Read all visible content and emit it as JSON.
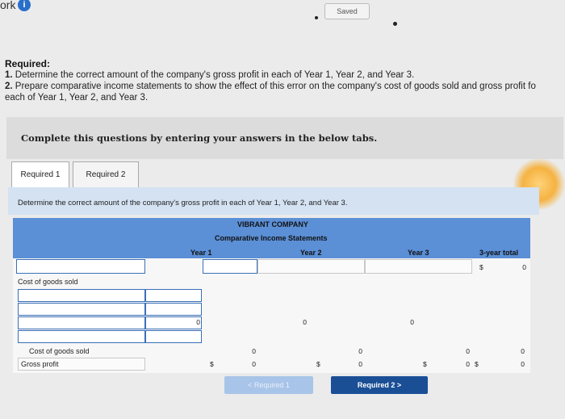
{
  "topbar": {
    "ork": "ork",
    "info_glyph": "i",
    "saved": "Saved"
  },
  "required": {
    "heading": "Required:",
    "item1_num": "1.",
    "item1": "Determine the correct amount of the company's gross profit in each of Year 1, Year 2, and Year 3.",
    "item2_num": "2.",
    "item2_a": "Prepare comparative income statements to show the effect of this error on the company's cost of goods sold and gross profit fo",
    "item2_b": "each of Year 1, Year 2, and Year 3."
  },
  "panel": {
    "text": "Complete this questions by entering your answers in the below tabs."
  },
  "tabs": [
    {
      "label": "Required 1"
    },
    {
      "label": "Required 2"
    }
  ],
  "instruction": "Determine the correct amount of the company's gross profit in each of Year 1, Year 2, and Year 3.",
  "statement": {
    "company": "VIBRANT COMPANY",
    "title": "Comparative Income Statements",
    "years": [
      "Year 1",
      "Year 2",
      "Year 3",
      "3-year total"
    ],
    "currency": "$",
    "total_top_value": "0",
    "rows": {
      "cogs_label": "Cost of goods sold",
      "subtotal": {
        "y1": "0",
        "y2": "0",
        "y3": "0"
      },
      "cogs2_label": "Cost of goods sold",
      "cogs2": {
        "y1": "0",
        "y2": "0",
        "y3": "0",
        "total": "0"
      },
      "gp_label": "Gross profit",
      "gp": {
        "y1": "0",
        "y2": "0",
        "y3": "0",
        "total": "0"
      }
    }
  },
  "nav": {
    "prev": "<  Required 1",
    "next": "Required 2  >"
  },
  "colors": {
    "header_band": "#5b8fd6",
    "primary_button": "#1a4f96",
    "instruction_bg": "#d4e2f2"
  }
}
